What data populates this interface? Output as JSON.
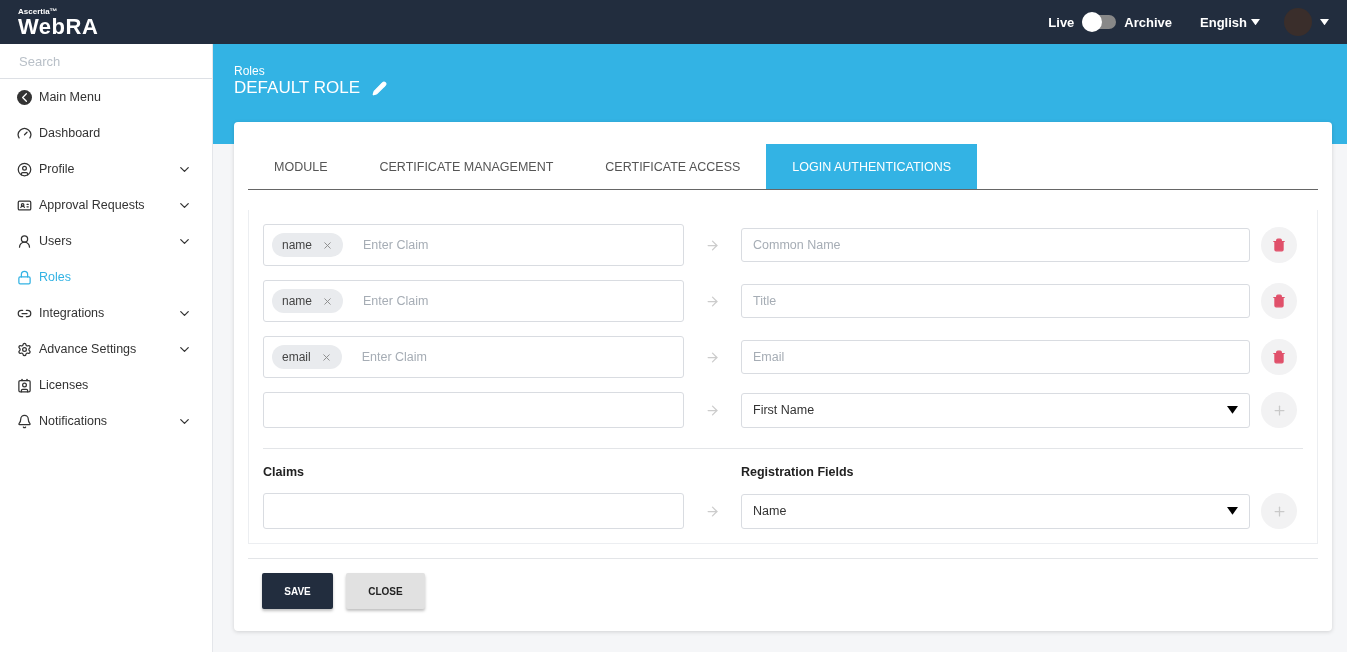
{
  "header": {
    "brand_small": "Ascertia™",
    "brand": "WebRA",
    "mode_left": "Live",
    "mode_right": "Archive",
    "archive_on": false,
    "language": "English"
  },
  "sidebar": {
    "search_placeholder": "Search",
    "items": [
      {
        "label": "Main Menu",
        "expandable": false,
        "selected": false
      },
      {
        "label": "Dashboard",
        "expandable": false,
        "selected": false
      },
      {
        "label": "Profile",
        "expandable": true,
        "selected": false
      },
      {
        "label": "Approval Requests",
        "expandable": true,
        "selected": false
      },
      {
        "label": "Users",
        "expandable": true,
        "selected": false
      },
      {
        "label": "Roles",
        "expandable": false,
        "selected": true
      },
      {
        "label": "Integrations",
        "expandable": true,
        "selected": false
      },
      {
        "label": "Advance Settings",
        "expandable": true,
        "selected": false
      },
      {
        "label": "Licenses",
        "expandable": false,
        "selected": false
      },
      {
        "label": "Notifications",
        "expandable": true,
        "selected": false
      }
    ]
  },
  "page": {
    "breadcrumb": "Roles",
    "title": "DEFAULT ROLE"
  },
  "tabs": [
    {
      "label": "MODULE",
      "selected": false
    },
    {
      "label": "CERTIFICATE MANAGEMENT",
      "selected": false
    },
    {
      "label": "CERTIFICATE ACCESS",
      "selected": false
    },
    {
      "label": "LOGIN AUTHENTICATIONS",
      "selected": true
    }
  ],
  "mappings": [
    {
      "kind": "text",
      "tags": [
        "name"
      ],
      "claim_placeholder": "Enter Claim",
      "field_placeholder": "Common Name"
    },
    {
      "kind": "text",
      "tags": [
        "name"
      ],
      "claim_placeholder": "Enter Claim",
      "field_placeholder": "Title"
    },
    {
      "kind": "text",
      "tags": [
        "email"
      ],
      "claim_placeholder": "Enter Claim",
      "field_placeholder": "Email"
    },
    {
      "kind": "select",
      "field_value": "First Name"
    }
  ],
  "new_mapping": {
    "claims_label": "Claims",
    "fields_label": "Registration Fields",
    "field_value": "Name"
  },
  "buttons": [
    {
      "label": "SAVE",
      "kind": "primary"
    },
    {
      "label": "CLOSE",
      "kind": "secondary"
    }
  ]
}
